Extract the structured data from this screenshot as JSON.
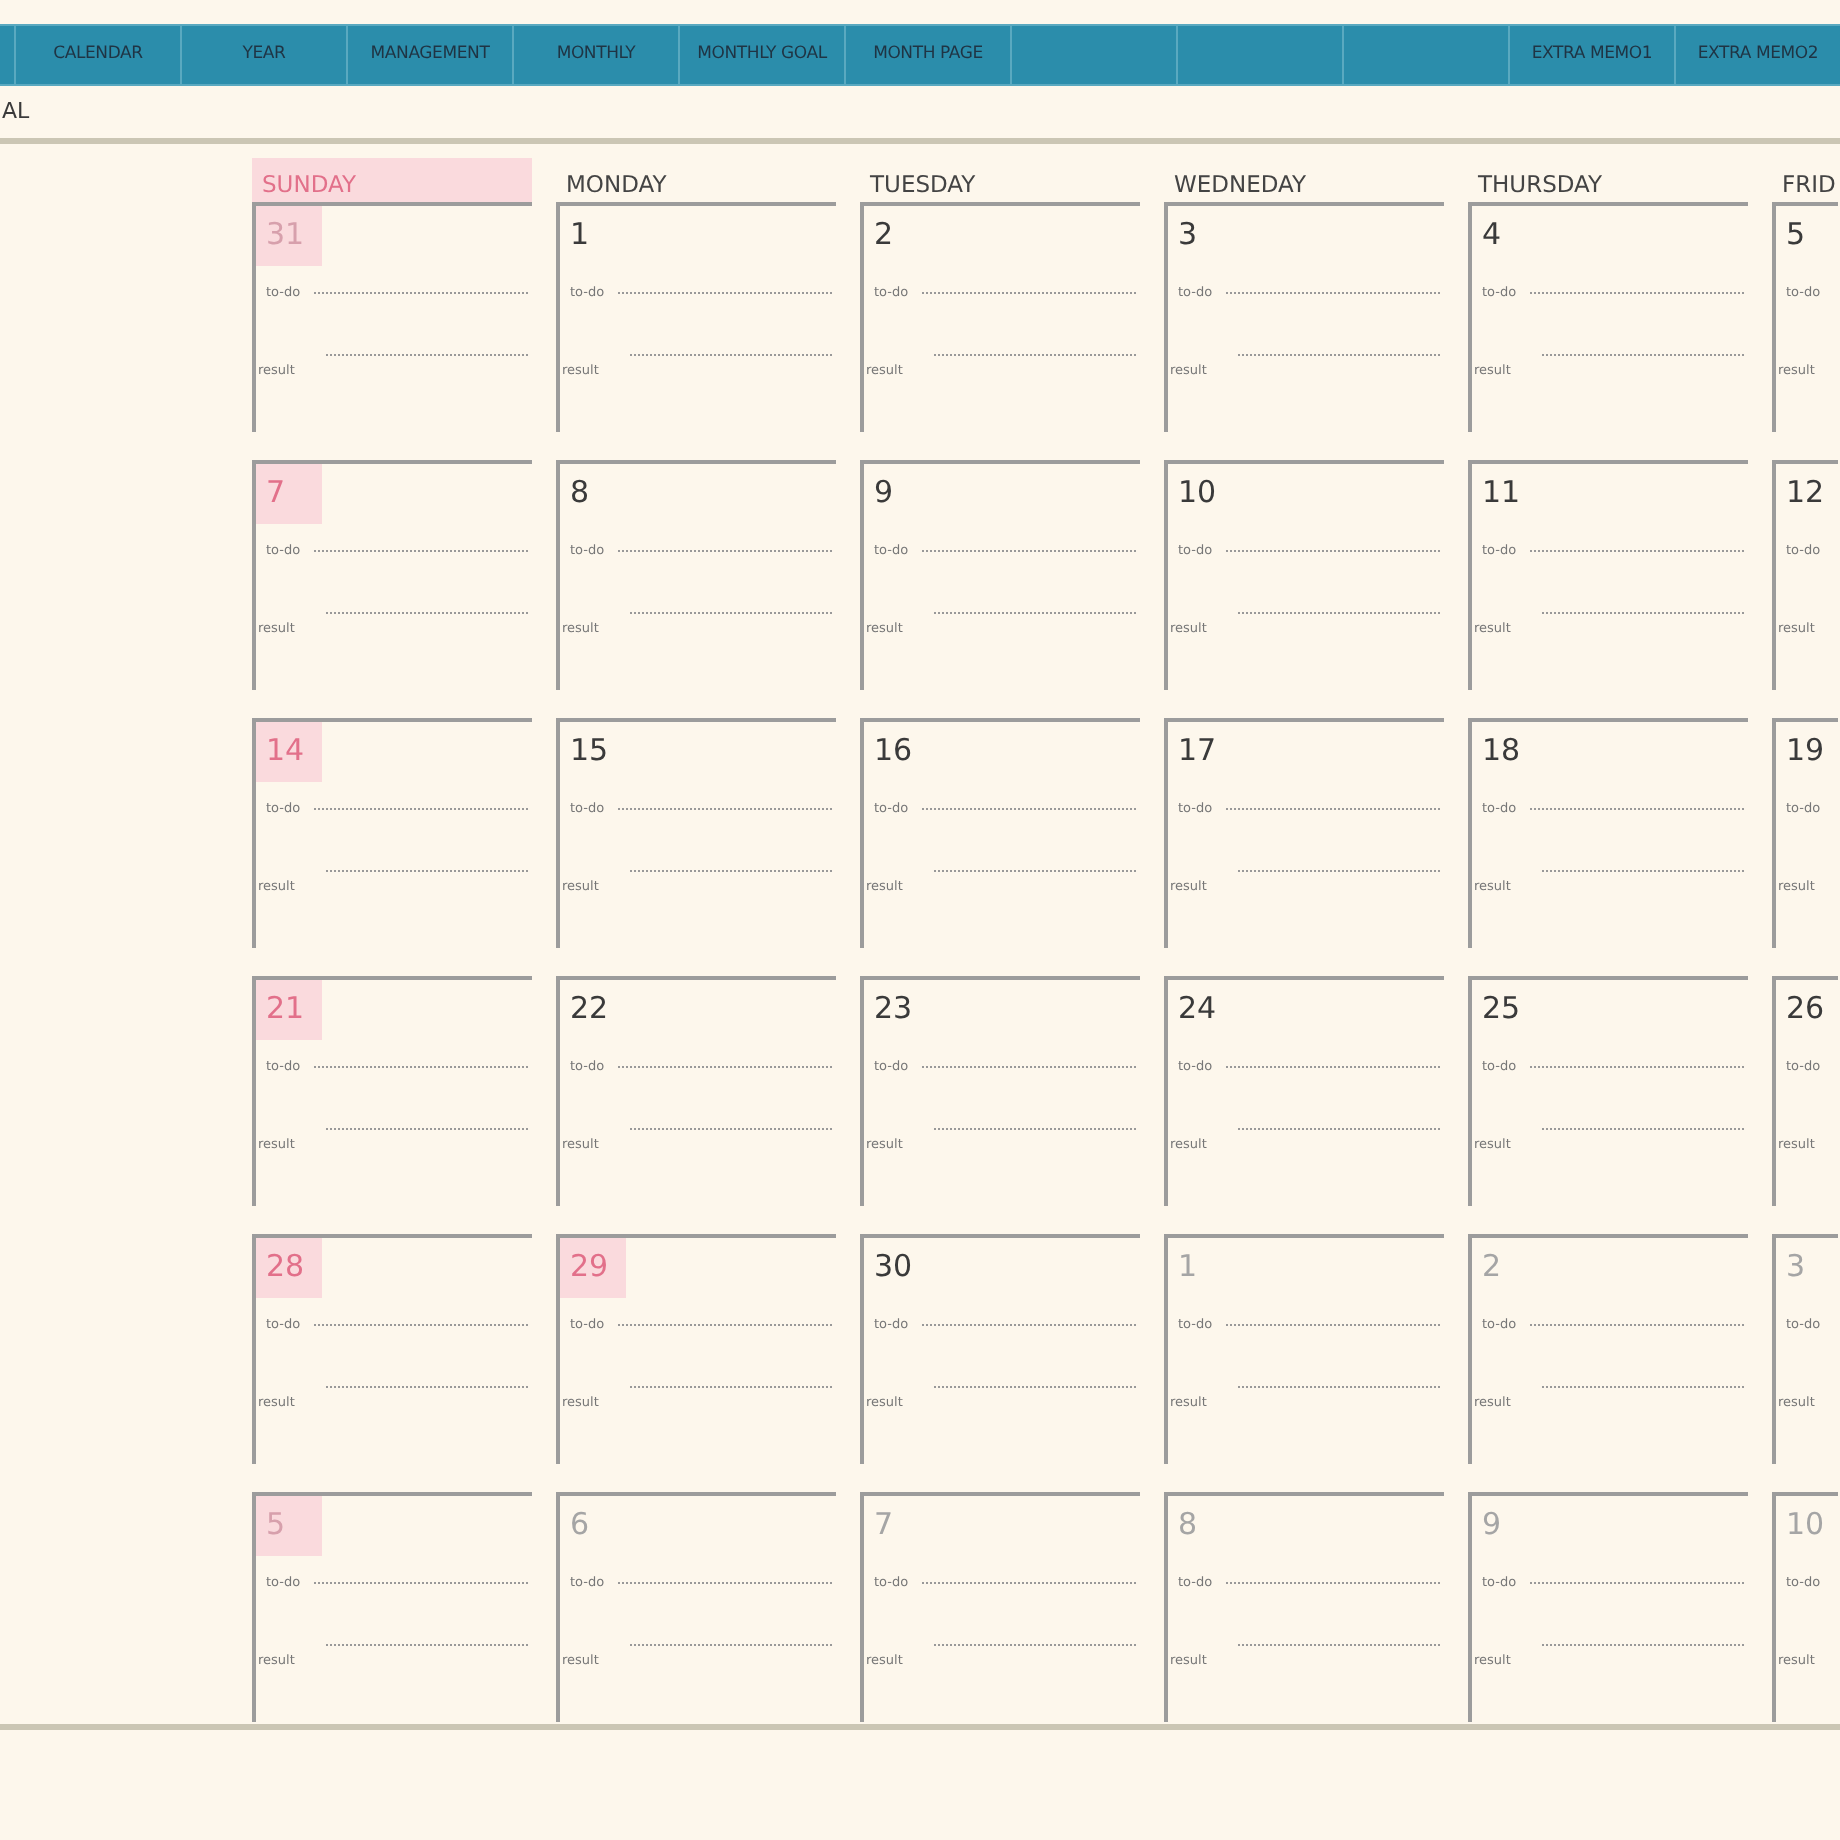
{
  "nav_tabs": [
    {
      "kind": "blank"
    },
    {
      "kind": "tab",
      "label": "CALENDAR"
    },
    {
      "kind": "tab",
      "label": "YEAR"
    },
    {
      "kind": "tab",
      "label": "MANAGEMENT"
    },
    {
      "kind": "tab",
      "label": "MONTHLY"
    },
    {
      "kind": "tab",
      "label": "MONTHLY GOAL"
    },
    {
      "kind": "tab",
      "label": "MONTH PAGE"
    },
    {
      "kind": "blank"
    },
    {
      "kind": "blank"
    },
    {
      "kind": "blank"
    },
    {
      "kind": "tab",
      "label": "EXTRA MEMO1"
    },
    {
      "kind": "tab",
      "label": "EXTRA MEMO2"
    }
  ],
  "page_label": "AL",
  "weekdays": [
    {
      "label": "SUNDAY",
      "highlighted": true
    },
    {
      "label": "MONDAY",
      "highlighted": false
    },
    {
      "label": "TUESDAY",
      "highlighted": false
    },
    {
      "label": "WEDNEDAY",
      "highlighted": false
    },
    {
      "label": "THURSDAY",
      "highlighted": false
    },
    {
      "label": "FRID",
      "highlighted": false
    }
  ],
  "weeks": [
    {
      "days": [
        {
          "date": "31",
          "other_month": true,
          "highlighted": true,
          "todo": "to-do",
          "result": "result"
        },
        {
          "date": "1",
          "other_month": false,
          "highlighted": false,
          "todo": "to-do",
          "result": "result"
        },
        {
          "date": "2",
          "other_month": false,
          "highlighted": false,
          "todo": "to-do",
          "result": "result"
        },
        {
          "date": "3",
          "other_month": false,
          "highlighted": false,
          "todo": "to-do",
          "result": "result"
        },
        {
          "date": "4",
          "other_month": false,
          "highlighted": false,
          "todo": "to-do",
          "result": "result"
        },
        {
          "date": "5",
          "other_month": false,
          "highlighted": false,
          "todo": "to-do",
          "result": "result"
        }
      ]
    },
    {
      "days": [
        {
          "date": "7",
          "other_month": false,
          "highlighted": true,
          "todo": "to-do",
          "result": "result"
        },
        {
          "date": "8",
          "other_month": false,
          "highlighted": false,
          "todo": "to-do",
          "result": "result"
        },
        {
          "date": "9",
          "other_month": false,
          "highlighted": false,
          "todo": "to-do",
          "result": "result"
        },
        {
          "date": "10",
          "other_month": false,
          "highlighted": false,
          "todo": "to-do",
          "result": "result"
        },
        {
          "date": "11",
          "other_month": false,
          "highlighted": false,
          "todo": "to-do",
          "result": "result"
        },
        {
          "date": "12",
          "other_month": false,
          "highlighted": false,
          "todo": "to-do",
          "result": "result"
        }
      ]
    },
    {
      "days": [
        {
          "date": "14",
          "other_month": false,
          "highlighted": true,
          "todo": "to-do",
          "result": "result"
        },
        {
          "date": "15",
          "other_month": false,
          "highlighted": false,
          "todo": "to-do",
          "result": "result"
        },
        {
          "date": "16",
          "other_month": false,
          "highlighted": false,
          "todo": "to-do",
          "result": "result"
        },
        {
          "date": "17",
          "other_month": false,
          "highlighted": false,
          "todo": "to-do",
          "result": "result"
        },
        {
          "date": "18",
          "other_month": false,
          "highlighted": false,
          "todo": "to-do",
          "result": "result"
        },
        {
          "date": "19",
          "other_month": false,
          "highlighted": false,
          "todo": "to-do",
          "result": "result"
        }
      ]
    },
    {
      "days": [
        {
          "date": "21",
          "other_month": false,
          "highlighted": true,
          "todo": "to-do",
          "result": "result"
        },
        {
          "date": "22",
          "other_month": false,
          "highlighted": false,
          "todo": "to-do",
          "result": "result"
        },
        {
          "date": "23",
          "other_month": false,
          "highlighted": false,
          "todo": "to-do",
          "result": "result"
        },
        {
          "date": "24",
          "other_month": false,
          "highlighted": false,
          "todo": "to-do",
          "result": "result"
        },
        {
          "date": "25",
          "other_month": false,
          "highlighted": false,
          "todo": "to-do",
          "result": "result"
        },
        {
          "date": "26",
          "other_month": false,
          "highlighted": false,
          "todo": "to-do",
          "result": "result"
        }
      ]
    },
    {
      "days": [
        {
          "date": "28",
          "other_month": false,
          "highlighted": true,
          "todo": "to-do",
          "result": "result"
        },
        {
          "date": "29",
          "other_month": false,
          "highlighted": true,
          "todo": "to-do",
          "result": "result"
        },
        {
          "date": "30",
          "other_month": false,
          "highlighted": false,
          "todo": "to-do",
          "result": "result"
        },
        {
          "date": "1",
          "other_month": true,
          "highlighted": false,
          "todo": "to-do",
          "result": "result"
        },
        {
          "date": "2",
          "other_month": true,
          "highlighted": false,
          "todo": "to-do",
          "result": "result"
        },
        {
          "date": "3",
          "other_month": true,
          "highlighted": false,
          "todo": "to-do",
          "result": "result"
        }
      ]
    },
    {
      "days": [
        {
          "date": "5",
          "other_month": true,
          "highlighted": true,
          "todo": "to-do",
          "result": "result"
        },
        {
          "date": "6",
          "other_month": true,
          "highlighted": false,
          "todo": "to-do",
          "result": "result"
        },
        {
          "date": "7",
          "other_month": true,
          "highlighted": false,
          "todo": "to-do",
          "result": "result"
        },
        {
          "date": "8",
          "other_month": true,
          "highlighted": false,
          "todo": "to-do",
          "result": "result"
        },
        {
          "date": "9",
          "other_month": true,
          "highlighted": false,
          "todo": "to-do",
          "result": "result"
        },
        {
          "date": "10",
          "other_month": true,
          "highlighted": false,
          "todo": "to-do",
          "result": "result"
        }
      ]
    }
  ]
}
